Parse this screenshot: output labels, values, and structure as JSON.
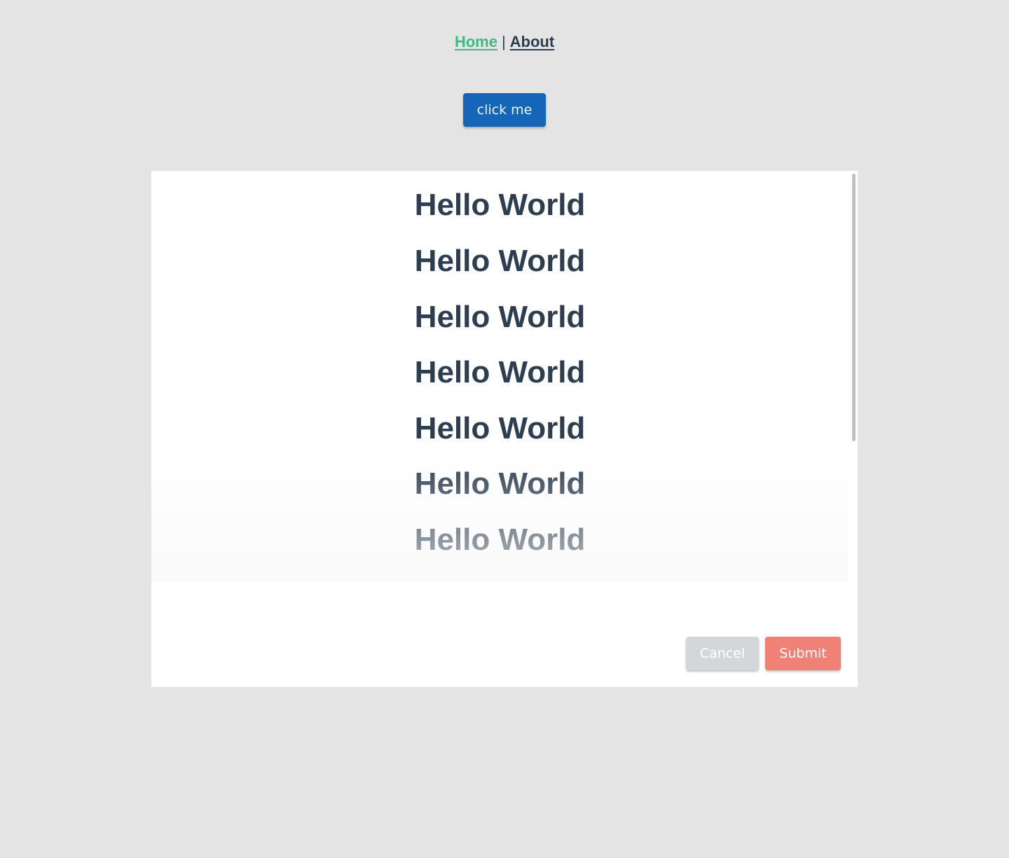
{
  "nav": {
    "links": [
      {
        "label": "Home",
        "active": true
      },
      {
        "label": "About",
        "active": false
      }
    ],
    "separator": "|"
  },
  "main": {
    "click_button_label": "click me"
  },
  "dialog": {
    "items": [
      "Hello World",
      "Hello World",
      "Hello World",
      "Hello World",
      "Hello World",
      "Hello World",
      "Hello World"
    ],
    "cancel_label": "Cancel",
    "submit_label": "Submit"
  },
  "colors": {
    "background": "#e4e4e4",
    "text": "#2c3e50",
    "active_link": "#42b983",
    "primary_button": "#1565b8",
    "cancel_button": "#d4d6d9",
    "submit_button": "#ef8176"
  }
}
